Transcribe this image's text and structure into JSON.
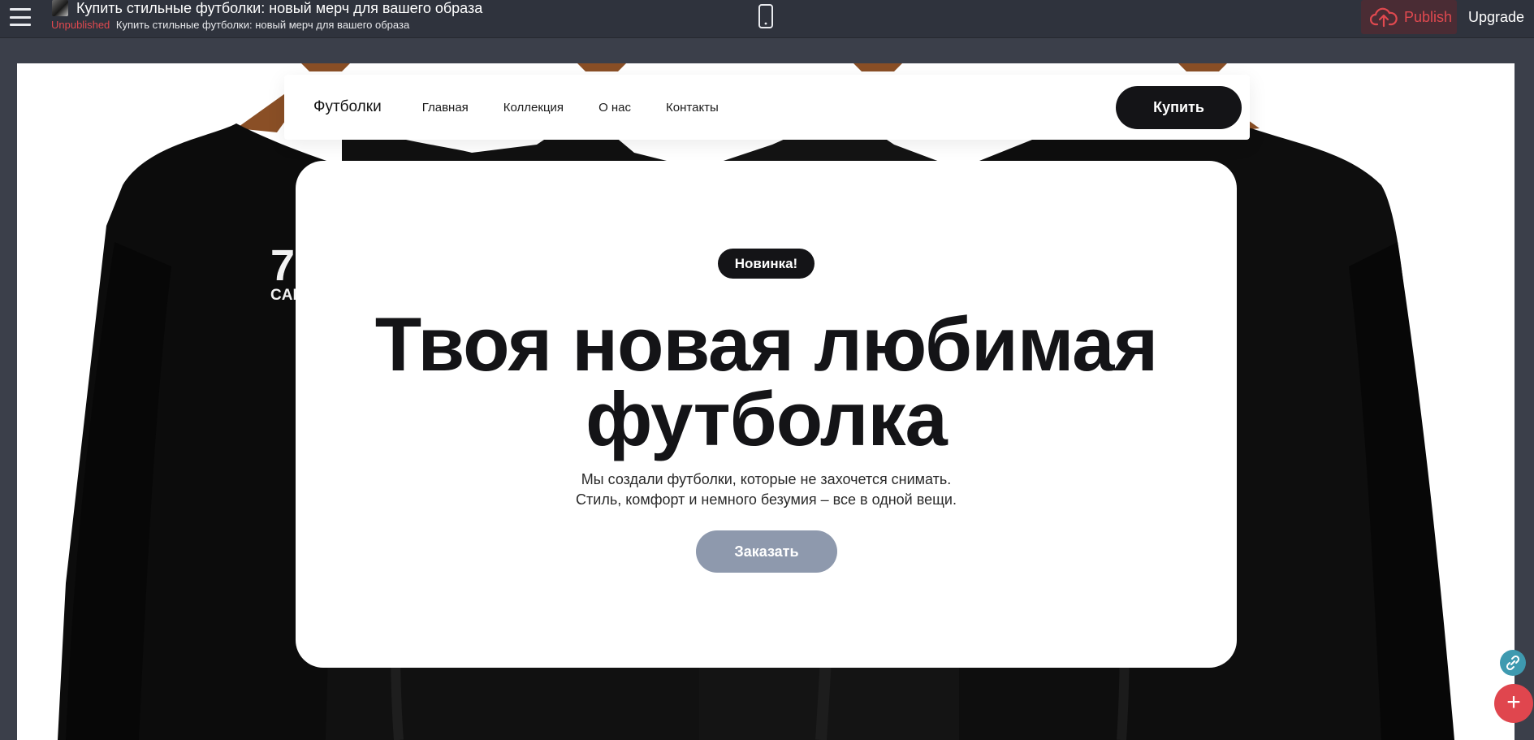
{
  "editor": {
    "page_title": "Купить стильные футболки: новый мерч для вашего образа",
    "status": "Unpublished",
    "page_path": "Купить стильные футболки: новый мерч для вашего образа",
    "publish_label": "Publish",
    "upgrade_label": "Upgrade",
    "icons": {
      "menu": "hamburger-icon",
      "device": "mobile-phone-icon",
      "publish": "cloud-upload-icon",
      "link": "link-icon",
      "add": "plus-icon"
    },
    "add_symbol": "+",
    "colors": {
      "topbar": "#2f333d",
      "publish_accent": "#e0494f",
      "fab_add": "#e0464e",
      "fab_link": "#3e9ab0"
    }
  },
  "site": {
    "nav": {
      "brand": "Футболки",
      "links": [
        "Главная",
        "Коллекция",
        "О нас",
        "Контакты"
      ],
      "cta": "Купить"
    },
    "hero": {
      "badge": "Новинка!",
      "headline_line1": "Твоя новая любимая",
      "headline_line2": "футболка",
      "sub_line1": "Мы создали футболки, которые не захочется снимать.",
      "sub_line2": "Стиль, комфорт и немного безумия – все в одной вещи.",
      "button": "Заказать",
      "shirt_print_left": "7",
      "shirt_print_left_sub": "CAL"
    },
    "colors": {
      "dark": "#141417",
      "button_muted": "#8e99ad"
    }
  }
}
